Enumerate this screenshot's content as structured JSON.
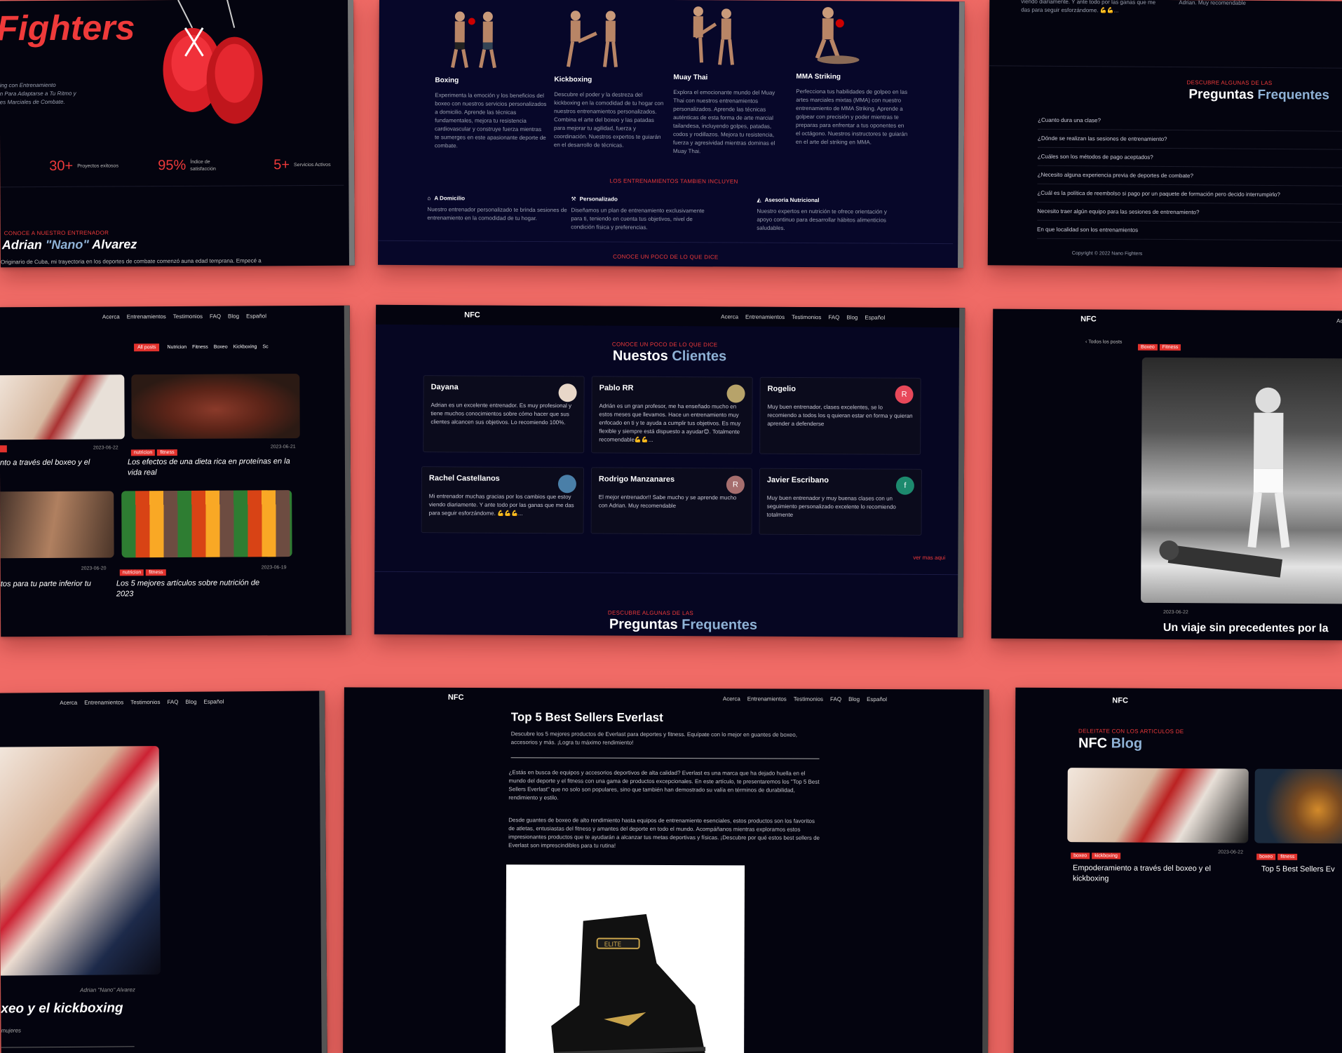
{
  "colors": {
    "background": "#f06b66",
    "accent": "#ef3a3a",
    "dark": "#04040f",
    "navy": "#070729",
    "highlight": "#8fb2d6"
  },
  "hero": {
    "title": "Fighters",
    "lines": [
      "ing con Entrenamiento",
      "n Para Adaptarse a Tu Ritmo y",
      "es Marciales de Combate."
    ],
    "stats": [
      {
        "num": "30+",
        "label": "Proyectos exitosos"
      },
      {
        "num": "95%",
        "label": "Índice de satisfacción"
      },
      {
        "num": "5+",
        "label": "Servicios Activos"
      }
    ],
    "trainer_kicker": "CONOCE A NUESTRO ENTRENADOR",
    "trainer_name_a": "Adrian ",
    "trainer_name_b": "\"Nano\"",
    "trainer_name_c": " Alvarez",
    "trainer_bio": "Originario de Cuba, mi trayectoria en los deportes de combate comenzó auna edad temprana. Empecé a"
  },
  "services": {
    "items": [
      {
        "title": "Boxing",
        "text": "Experimenta la emoción y los beneficios del boxeo con nuestros servicios personalizados a domicilio. Aprende las técnicas fundamentales, mejora tu resistencia cardiovascular y construye fuerza mientras te sumerges en este apasionante deporte de combate."
      },
      {
        "title": "Kickboxing",
        "text": "Descubre el poder y la destreza del kickboxing en la comodidad de tu hogar con nuestros entrenamientos personalizados. Combina el arte del boxeo y las patadas para mejorar tu agilidad, fuerza y coordinación. Nuestros expertos te guiarán en el desarrollo de técnicas."
      },
      {
        "title": "Muay Thai",
        "text": "Explora el emocionante mundo del Muay Thai con nuestros entrenamientos personalizados. Aprende las técnicas auténticas de esta forma de arte marcial tailandesa, incluyendo golpes, patadas, codos y rodillazos. Mejora tu resistencia, fuerza y agresividad mientras dominas el Muay Thai."
      },
      {
        "title": "MMA Striking",
        "text": "Perfecciona tus habilidades de golpeo en las artes marciales mixtas (MMA) con nuestro entrenamiento de MMA Striking. Aprende a golpear con precisión y poder mientras te preparas para enfrentar a tus oponentes en el octágono. Nuestros instructores te guiarán en el arte del striking en MMA."
      }
    ],
    "includes_kicker": "LOS ENTRENAMIENTOS TAMBIEN INCLUYEN",
    "includes": [
      {
        "title": "A Domicilio",
        "text": "Nuestro entrenador personalizado te brinda sesiones de entrenamiento en la comodidad de tu hogar."
      },
      {
        "title": "Personalizado",
        "text": "Diseñamos un plan de entrenamiento exclusivamente para ti, teniendo en cuenta tus objetivos, nivel de condición física y preferencias."
      },
      {
        "title": "Asesoria Nutricional",
        "text": "Nuestro expertos en nutrición te ofrece orientación y apoyo continuo para desarrollar hábitos alimenticios saludables."
      }
    ],
    "bottom_kicker": "CONOCE UN POCO DE LO QUE DICE"
  },
  "faq_panel": {
    "top_text_a": "viendo diariamente. Y ante todo por las ganas que me das para seguir esforzándome. 💪💪...",
    "top_text_b": "Adrian. Muy recomendable",
    "kicker": "DESCUBRE ALGUNAS DE LAS",
    "title_a": "Preguntas ",
    "title_b": "Frequentes",
    "questions": [
      "¿Cuanto dura una clase?",
      "¿Dónde se realizan las sesiones de entrenamiento?",
      "¿Cuáles son los métodos de pago aceptados?",
      "¿Necesito alguna experiencia previa de deportes de combate?",
      "¿Cuál es la política de reembolso si pago por un paquete de formación pero decido interrumpirlo?",
      "Necesito traer algún equipo para las sesiones de entrenamiento?",
      "En que localidad son los entrenamientos"
    ],
    "copyright": "Copyright © 2022 Nano Fighters"
  },
  "nav": {
    "logo": "NFC",
    "items": [
      "Acerca",
      "Entrenamientos",
      "Testimonios",
      "FAQ",
      "Blog",
      "Español"
    ]
  },
  "blog_list": {
    "filters": [
      "All posts",
      "Nutricion",
      "Fitness",
      "Boxeo",
      "Kickboxing",
      "Sc"
    ],
    "posts": [
      {
        "tags": [],
        "date": "2023-06-22",
        "title": "nto a través del boxeo y el"
      },
      {
        "tags": [
          "nutricion",
          "fitness"
        ],
        "date": "2023-06-21",
        "title": "Los efectos de una dieta rica en proteínas en la vida real"
      },
      {
        "tags": [],
        "date": "2023-06-20",
        "title": "tos para tu parte inferior tu"
      },
      {
        "tags": [
          "nutricion",
          "fitness"
        ],
        "date": "2023-06-19",
        "title": "Los 5 mejores artículos sobre nutrición de 2023"
      }
    ]
  },
  "testimonials": {
    "kicker": "CONOCE UN POCO DE LO QUE DICE",
    "title_a": "Nuestos ",
    "title_b": "Clientes",
    "cards": [
      {
        "name": "Dayana",
        "initial": "",
        "color": "#e8d7c8",
        "text": "Adrian es un excelente entrenador. Es muy profesional y tiene muchos conocimientos sobre cómo hacer que sus clientes alcancen sus objetivos. Lo recomiendo 100%."
      },
      {
        "name": "Pablo RR",
        "initial": "",
        "color": "#b7a36a",
        "text": "Adrián es un gran profesor, me ha enseñado mucho en estos meses que llevamos. Hace un entrenamiento muy enfocado en ti y te ayuda a cumplir tus objetivos. Es muy flexible y siempre está dispuesto a ayudar😊. Totalmente recomendable💪💪..."
      },
      {
        "name": "Rogelio",
        "initial": "R",
        "color": "#e8485a",
        "text": "Muy buen entrenador, clases excelentes, se lo recomiendo a todos los q quieran estar en forma y quieran aprender a defenderse"
      },
      {
        "name": "Rachel Castellanos",
        "initial": "",
        "color": "#4a7fa8",
        "text": "Mi entrenador muchas gracias por los cambios que estoy viendo diariamente. Y ante todo por las ganas que me das para seguir esforzándome. 💪💪💪..."
      },
      {
        "name": "Rodrigo Manzanares",
        "initial": "R",
        "color": "#a66e6e",
        "text": "El mejor entrenador!! Sabe mucho y se aprende mucho con Adrian. Muy recomendable"
      },
      {
        "name": "Javier Escribano",
        "initial": "f",
        "color": "#1d8a6e",
        "text": "Muy buen entrenador y muy buenas clases con un seguimiento personalizado excelente lo recomiendo totalmente"
      }
    ],
    "more": "ver mas aqui",
    "faq_kicker": "DESCUBRE ALGUNAS DE LAS",
    "faq_title_a": "Preguntas ",
    "faq_title_b": "Frequentes"
  },
  "post_detail": {
    "back": "Todos los posts",
    "tags": [
      "Boxeo",
      "Fitness"
    ],
    "date": "2023-06-22",
    "title": "Un viaje sin precedentes por la"
  },
  "article_left": {
    "author": "Adrian \"Nano\" Alvarez",
    "title": "xeo y el kickboxing",
    "sub": "mujeres"
  },
  "article": {
    "title": "Top 5 Best Sellers Everlast",
    "lead": "Descubre los 5 mejores productos de Everlast para deportes y fitness. Equípate con lo mejor en guantes de boxeo, accesorios y más. ¡Logra tu máximo rendimiento!",
    "p1": "¿Estás en busca de equipos y accesorios deportivos de alta calidad? Everlast es una marca que ha dejado huella en el mundo del deporte y el fitness con una gama de productos excepcionales. En este artículo, te presentaremos los \"Top 5 Best Sellers Everlast\" que no solo son populares, sino que también han demostrado su valía en términos de durabilidad, rendimiento y estilo.",
    "p2": "Desde guantes de boxeo de alto rendimiento hasta equipos de entrenamiento esenciales, estos productos son los favoritos de atletas, entusiastas del fitness y amantes del deporte en todo el mundo. Acompáñanos mientras exploramos estos impresionantes productos que te ayudarán a alcanzar tus metas deportivas y físicas. ¡Descubre por qué estos best sellers de Everlast son imprescindibles para tu rutina!",
    "shoe_brand": "ELITE"
  },
  "blog_home": {
    "kicker": "DELEITATE CON LOS ARTICULOS DE",
    "title_a": "NFC ",
    "title_b": "Blog",
    "posts": [
      {
        "tags": [
          "boxeo",
          "kickboxing"
        ],
        "date": "2023-06-22",
        "title": "Empoderamiento a través del boxeo y el kickboxing"
      },
      {
        "tags": [
          "boxeo",
          "fitness"
        ],
        "date": "",
        "title": "Top 5 Best Sellers Ev"
      }
    ]
  }
}
